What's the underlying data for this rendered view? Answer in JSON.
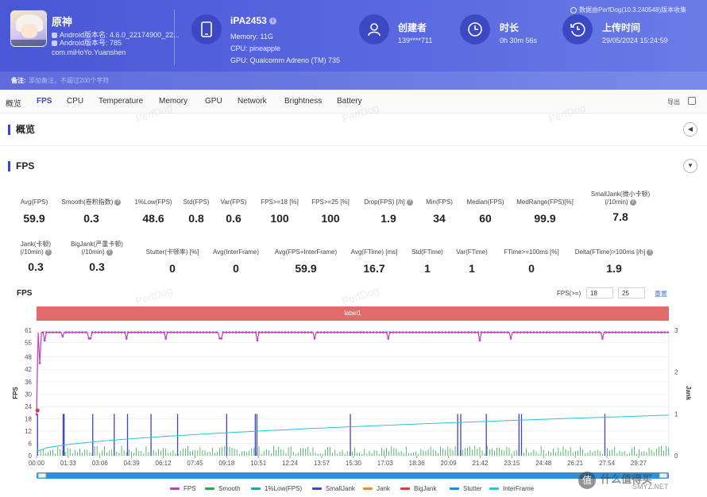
{
  "header": {
    "app": {
      "name": "原神",
      "version": "Android版本名: 4.6.0_22174900_22...",
      "version_code": "Android版本号: 785",
      "package": "com.miHoYo.Yuanshen"
    },
    "device": {
      "name": "iPA2453",
      "memory": "Memory: 11G",
      "cpu": "CPU: pineapple",
      "gpu": "GPU: Qualcomm Adreno (TM) 735"
    },
    "creator": {
      "label": "创建者",
      "value": "139****711"
    },
    "duration": {
      "label": "时长",
      "value": "0h 30m 56s"
    },
    "upload": {
      "label": "上传时间",
      "value": "29/05/2024 15:24:59"
    },
    "info": "数据由PerfDog(10.3.240548)版本收集",
    "note_label": "备注:",
    "note_placeholder": "添加备注，不超过200个字符"
  },
  "tabs": [
    "概览",
    "FPS",
    "CPU",
    "Temperature",
    "Memory",
    "GPU",
    "Network",
    "Brightness",
    "Battery"
  ],
  "export_label": "导出",
  "overview_title": "概览",
  "fps_title": "FPS",
  "stats_row1": [
    {
      "label": "Avg(FPS)",
      "value": "59.9"
    },
    {
      "label": "Smooth(卷积指数)",
      "value": "0.3"
    },
    {
      "label": "1%Low(FPS)",
      "value": "48.6"
    },
    {
      "label": "Std(FPS)",
      "value": "0.8"
    },
    {
      "label": "Var(FPS)",
      "value": "0.6"
    },
    {
      "label": "FPS>=18 [%]",
      "value": "100"
    },
    {
      "label": "FPS>=25 [%]",
      "value": "100"
    },
    {
      "label": "Drop(FPS) [/h]",
      "value": "1.9"
    },
    {
      "label": "Min(FPS)",
      "value": "34"
    },
    {
      "label": "Median(FPS)",
      "value": "60"
    },
    {
      "label": "MedRange(FPS)[%]",
      "value": "99.9"
    },
    {
      "label": "SmallJank(微小卡顿)",
      "label2": "(/10min)",
      "value": "7.8"
    }
  ],
  "stats_row2": [
    {
      "label": "Jank(卡顿)",
      "label2": "(/10min)",
      "value": "0.3"
    },
    {
      "label": "BigJank(严重卡顿)",
      "label2": "(/10min)",
      "value": "0.3"
    },
    {
      "label": "Stutter(卡顿率) [%]",
      "value": "0"
    },
    {
      "label": "Avg(InterFrame)",
      "value": "0"
    },
    {
      "label": "Avg(FPS+InterFrame)",
      "value": "59.9"
    },
    {
      "label": "Avg(FTime) [ms]",
      "value": "16.7"
    },
    {
      "label": "Std(FTime)",
      "value": "1"
    },
    {
      "label": "Var(FTime)",
      "value": "1"
    },
    {
      "label": "FTime>=100ms [%]",
      "value": "0"
    },
    {
      "label": "Delta(FTime)>100ms [/h]",
      "value": "1.9"
    }
  ],
  "chart_header": {
    "title": "FPS",
    "filter_label": "FPS(>=)",
    "filter_a": "18",
    "filter_b": "25",
    "reset": "重置",
    "label_bar": "label1"
  },
  "chart_data": {
    "type": "line",
    "ylabel": "FPS",
    "y2label": "Jank",
    "ylim": [
      0,
      61
    ],
    "y2lim": [
      0,
      3
    ],
    "yticks": [
      0,
      6,
      12,
      18,
      24,
      30,
      36,
      42,
      48,
      55,
      61
    ],
    "y2ticks": [
      0,
      1,
      2,
      3
    ],
    "x_ticks": [
      "00:00",
      "01:33",
      "03:06",
      "04:39",
      "06:12",
      "07:45",
      "09:18",
      "10:51",
      "12:24",
      "13:57",
      "15:30",
      "17:03",
      "18:36",
      "20:09",
      "21:42",
      "23:15",
      "24:48",
      "26:21",
      "27:54",
      "29:27"
    ],
    "duration_min": 30.93,
    "series": [
      {
        "name": "FPS",
        "color": "#c040c0",
        "baseline": 60,
        "dips": [
          [
            0.0,
            20
          ],
          [
            0.15,
            45
          ],
          [
            0.4,
            56
          ],
          [
            1.3,
            58
          ],
          [
            2.6,
            57
          ],
          [
            4.4,
            57
          ],
          [
            6.3,
            57
          ],
          [
            9.0,
            57
          ],
          [
            10.8,
            56
          ],
          [
            13.6,
            57
          ],
          [
            17.2,
            57
          ],
          [
            21.7,
            56
          ],
          [
            23.2,
            57
          ],
          [
            27.7,
            57
          ]
        ]
      },
      {
        "name": "Smooth",
        "color": "#2ea84a"
      },
      {
        "name": "1%Low(FPS)",
        "color": "#1fa9a0"
      },
      {
        "name": "SmallJank",
        "color": "#3b46c8",
        "events": [
          0.05,
          1.3,
          1.35,
          2.75,
          3.8,
          4.45,
          5.6,
          6.9,
          9.3,
          10.7,
          10.78,
          15.35,
          20.6,
          20.75,
          22.0,
          23.6,
          23.72,
          27.8
        ]
      },
      {
        "name": "Jank",
        "color": "#f28a2a"
      },
      {
        "name": "BigJank",
        "color": "#e53935"
      },
      {
        "name": "Stutter",
        "color": "#1e88e5"
      },
      {
        "name": "InterFrame",
        "color": "#26c6da",
        "start": 0.1,
        "end": 0.97
      }
    ]
  },
  "brand": {
    "mark": "值",
    "name": "什么值得买",
    "domain": "SMYZ.NET"
  },
  "watermark": "PerfDog"
}
